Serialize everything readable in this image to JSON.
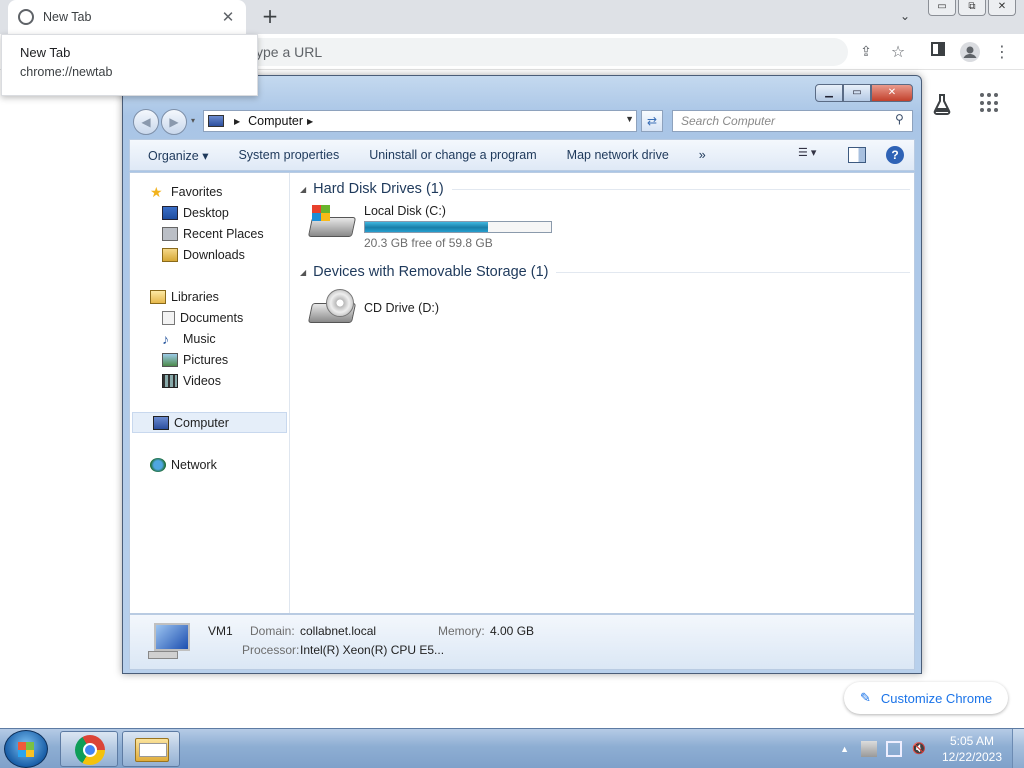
{
  "chrome": {
    "tab": {
      "title": "New Tab",
      "close_glyph": "✕",
      "favicon": "chrome-icon"
    },
    "new_tab_glyph": "+",
    "tab_search_glyph": "⌄",
    "window_controls": [
      "▭",
      "⧉",
      "✕"
    ],
    "omnibox_placeholder": "ype a URL",
    "toolbar_icons": [
      "share-icon",
      "star-icon",
      "side-panel-icon",
      "profile-icon",
      "menu-icon"
    ],
    "tooltip": {
      "title": "New Tab",
      "url": "chrome://newtab"
    },
    "ntp": {
      "customize_label": "Customize Chrome",
      "customize_icon": "pencil-icon",
      "labs_icon": "flask-icon",
      "apps_icon": "apps-grid-icon"
    }
  },
  "explorer": {
    "caption_buttons": [
      "▁",
      "▭",
      "✕"
    ],
    "breadcrumb": [
      "Computer"
    ],
    "search_placeholder": "Search Computer",
    "commands": [
      "Organize ▾",
      "System properties",
      "Uninstall or change a program",
      "Map network drive",
      "»"
    ],
    "nav": {
      "favorites": {
        "label": "Favorites",
        "items": [
          "Desktop",
          "Recent Places",
          "Downloads"
        ]
      },
      "libraries": {
        "label": "Libraries",
        "items": [
          "Documents",
          "Music",
          "Pictures",
          "Videos"
        ]
      },
      "computer": "Computer",
      "network": "Network"
    },
    "groups": [
      {
        "title": "Hard Disk Drives (1)",
        "drives": [
          {
            "name": "Local Disk (C:)",
            "free_text": "20.3 GB free of 59.8 GB",
            "used_fraction": 0.66
          }
        ]
      },
      {
        "title": "Devices with Removable Storage (1)",
        "drives": [
          {
            "name": "CD Drive (D:)"
          }
        ]
      }
    ],
    "details": {
      "name": "VM1",
      "domain_label": "Domain:",
      "domain_value": "collabnet.local",
      "memory_label": "Memory:",
      "memory_value": "4.00 GB",
      "processor_label": "Processor:",
      "processor_value": "Intel(R) Xeon(R) CPU E5..."
    }
  },
  "taskbar": {
    "pinned": [
      "chrome-icon",
      "explorer-folder-icon"
    ],
    "clock_time": "5:05 AM",
    "clock_date": "12/22/2023"
  }
}
